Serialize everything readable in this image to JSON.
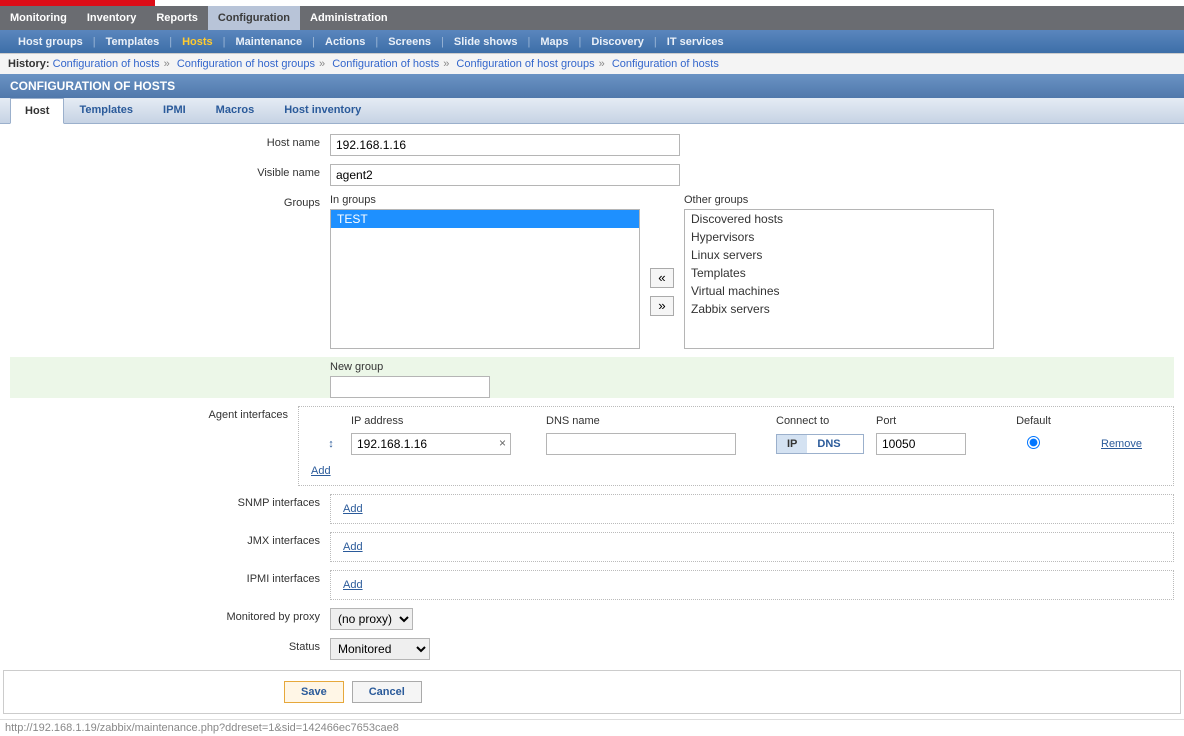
{
  "mainNav": {
    "items": [
      {
        "label": "Monitoring"
      },
      {
        "label": "Inventory"
      },
      {
        "label": "Reports"
      },
      {
        "label": "Configuration",
        "active": true
      },
      {
        "label": "Administration"
      }
    ]
  },
  "subNav": {
    "items": [
      {
        "label": "Host groups"
      },
      {
        "label": "Templates"
      },
      {
        "label": "Hosts",
        "active": true
      },
      {
        "label": "Maintenance"
      },
      {
        "label": "Actions"
      },
      {
        "label": "Screens"
      },
      {
        "label": "Slide shows"
      },
      {
        "label": "Maps"
      },
      {
        "label": "Discovery"
      },
      {
        "label": "IT services"
      }
    ]
  },
  "history": {
    "label": "History:",
    "crumbs": [
      "Configuration of hosts",
      "Configuration of host groups",
      "Configuration of hosts",
      "Configuration of host groups",
      "Configuration of hosts"
    ]
  },
  "pageTitle": "CONFIGURATION OF HOSTS",
  "formTabs": [
    {
      "label": "Host",
      "active": true
    },
    {
      "label": "Templates"
    },
    {
      "label": "IPMI"
    },
    {
      "label": "Macros"
    },
    {
      "label": "Host inventory"
    }
  ],
  "labels": {
    "hostName": "Host name",
    "visibleName": "Visible name",
    "groups": "Groups",
    "inGroups": "In groups",
    "otherGroups": "Other groups",
    "newGroup": "New group",
    "agentInterfaces": "Agent interfaces",
    "snmpInterfaces": "SNMP interfaces",
    "jmxInterfaces": "JMX interfaces",
    "ipmiInterfaces": "IPMI interfaces",
    "monitoredByProxy": "Monitored by proxy",
    "status": "Status",
    "ipAddress": "IP address",
    "dnsName": "DNS name",
    "connectTo": "Connect to",
    "port": "Port",
    "default": "Default",
    "remove": "Remove",
    "add": "Add",
    "ip": "IP",
    "dns": "DNS",
    "moveLeft": "«",
    "moveRight": "»"
  },
  "values": {
    "hostName": "192.168.1.16",
    "visibleName": "agent2",
    "newGroup": "",
    "proxy": "(no proxy)",
    "status": "Monitored"
  },
  "inGroups": [
    {
      "label": "TEST",
      "selected": true
    }
  ],
  "otherGroups": [
    {
      "label": "Discovered hosts"
    },
    {
      "label": "Hypervisors"
    },
    {
      "label": "Linux servers"
    },
    {
      "label": "Templates"
    },
    {
      "label": "Virtual machines"
    },
    {
      "label": "Zabbix servers"
    }
  ],
  "agentInterface": {
    "ip": "192.168.1.16",
    "dns": "",
    "connectIP": true,
    "port": "10050",
    "default": true
  },
  "buttons": {
    "save": "Save",
    "cancel": "Cancel"
  },
  "statusBar": "http://192.168.1.19/zabbix/maintenance.php?ddreset=1&sid=142466ec7653cae8"
}
